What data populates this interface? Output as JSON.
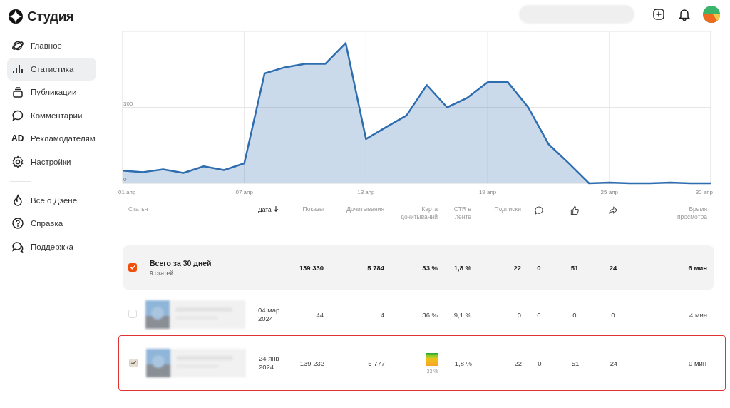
{
  "sidebar": {
    "logo": "Студия",
    "items": [
      {
        "label": "Главное",
        "selected": false
      },
      {
        "label": "Статистика",
        "selected": true
      },
      {
        "label": "Публикации",
        "selected": false
      },
      {
        "label": "Комментарии",
        "selected": false
      },
      {
        "icon_text": "AD",
        "label": "Рекламодателям",
        "selected": false
      },
      {
        "label": "Настройки",
        "selected": false
      }
    ],
    "secondary_items": [
      {
        "label": "Всё о Дзене",
        "selected": false
      },
      {
        "label": "Справка",
        "selected": false
      },
      {
        "label": "Поддержка",
        "selected": false
      }
    ]
  },
  "chart": {
    "chart_data": {
      "type": "area",
      "grid": true,
      "x": [
        1,
        2,
        3,
        4,
        5,
        6,
        7,
        8,
        9,
        10,
        11,
        12,
        13,
        14,
        15,
        16,
        17,
        18,
        19,
        20,
        21,
        22,
        23,
        24,
        25,
        26,
        27,
        28,
        29,
        30
      ],
      "series": [
        {
          "color": "#2e6db0",
          "values": [
            50,
            44,
            55,
            41,
            67,
            52,
            79,
            434,
            458,
            472,
            472,
            554,
            175,
            222,
            268,
            388,
            300,
            338,
            399,
            399,
            300,
            155,
            79,
            0,
            3,
            0,
            0,
            3,
            0,
            0
          ]
        }
      ],
      "ylim": [
        0,
        600
      ],
      "yticks": [
        0,
        300
      ],
      "xlim": [
        1,
        30
      ],
      "xticks": [
        {
          "value": 1,
          "label": "01 апр"
        },
        {
          "value": 7,
          "label": "07 апр"
        },
        {
          "value": 13,
          "label": "13 апр"
        },
        {
          "value": 19,
          "label": "19 апр"
        },
        {
          "value": 25,
          "label": "25 апр"
        },
        {
          "value": 30,
          "label": "30 апр"
        }
      ]
    }
  },
  "table": {
    "columns": [
      {
        "kind": "text",
        "label": "Статья",
        "sorted": false
      },
      {
        "kind": "text",
        "label": "Дата",
        "sorted": true
      },
      {
        "kind": "text",
        "label": "Показы",
        "sorted": false
      },
      {
        "kind": "text",
        "label": "Дочитывания",
        "sorted": false
      },
      {
        "kind": "text",
        "label": "Карта дочитываний",
        "sorted": false
      },
      {
        "kind": "text",
        "label": "CTR в ленте",
        "sorted": false
      },
      {
        "kind": "text",
        "label": "Подписки",
        "sorted": false
      },
      {
        "kind": "comment",
        "sorted": false
      },
      {
        "kind": "like",
        "sorted": false
      },
      {
        "kind": "share",
        "sorted": false
      },
      {
        "kind": "text",
        "label": "Время просмотра",
        "sorted": false
      }
    ],
    "total": {
      "checked": true,
      "title": "Всего за 30 дней",
      "subtitle": "9 статей",
      "cells": [
        "139 330",
        "5 784",
        "33 %",
        "1,8 %",
        "22",
        "0",
        "51",
        "24",
        "6 мин"
      ]
    },
    "rows": [
      {
        "checked": false,
        "outlined": false,
        "date": "04 мар 2024",
        "shows": "44",
        "reads": "4",
        "read_map": {
          "kind": "text",
          "label": "36 %"
        },
        "ctr": "9,1 %",
        "subs": "0",
        "comments": "0",
        "likes": "0",
        "shares": "0",
        "time": "4 мин"
      },
      {
        "checked": true,
        "outlined": true,
        "date": "24 янв 2024",
        "shows": "139 232",
        "reads": "5 777",
        "read_map": {
          "kind": "bar",
          "label": "33 %"
        },
        "ctr": "1,8 %",
        "subs": "22",
        "comments": "0",
        "likes": "51",
        "shares": "24",
        "time": "0 мин"
      }
    ]
  }
}
